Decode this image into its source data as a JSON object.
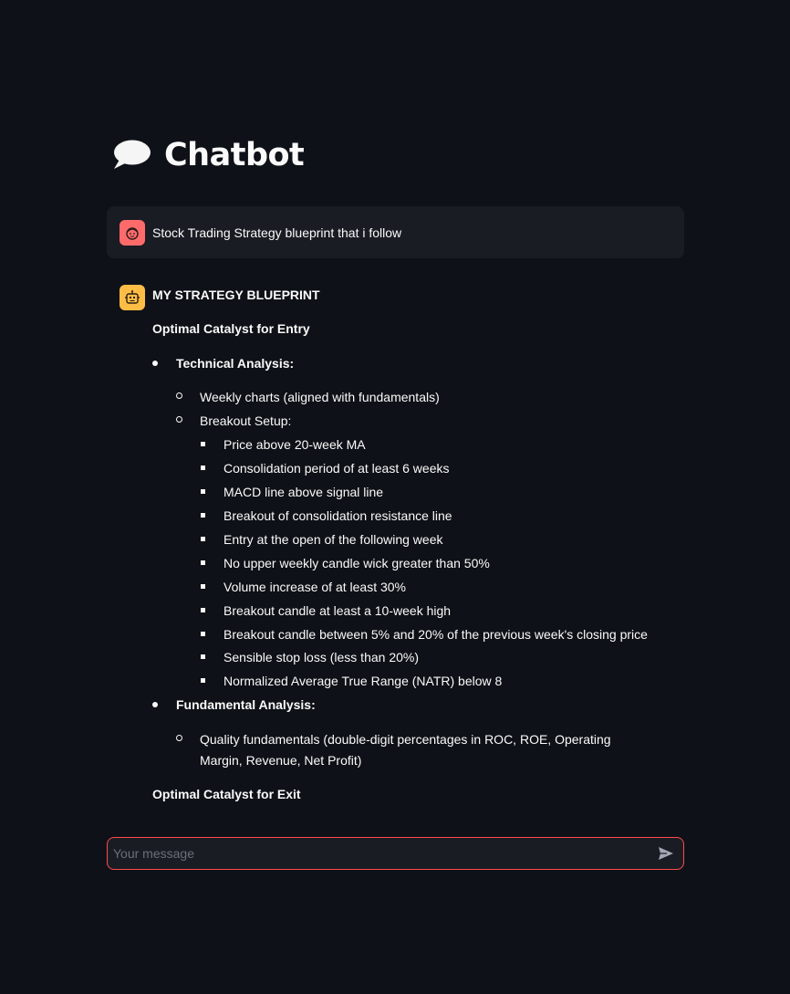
{
  "header": {
    "title": "Chatbot",
    "icon": "speech-bubble-icon"
  },
  "user_message": {
    "text": "Stock Trading Strategy blueprint that i follow"
  },
  "bot_message": {
    "heading": "MY STRATEGY BLUEPRINT",
    "entry_title": "Optimal Catalyst for Entry",
    "technical": {
      "label": "Technical Analysis:",
      "weekly": "Weekly charts (aligned with fundamentals)",
      "breakout_label": "Breakout Setup:",
      "breakout_items": [
        "Price above 20-week MA",
        "Consolidation period of at least 6 weeks",
        "MACD line above signal line",
        "Breakout of consolidation resistance line",
        "Entry at the open of the following week",
        "No upper weekly candle wick greater than 50%",
        "Volume increase of at least 30%",
        "Breakout candle at least a 10-week high",
        "Breakout candle between 5% and 20% of the previous week's closing price",
        "Sensible stop loss (less than 20%)",
        "Normalized Average True Range (NATR) below 8"
      ]
    },
    "fundamental": {
      "label": "Fundamental Analysis:",
      "quality": "Quality fundamentals (double-digit percentages in ROC, ROE, Operating Margin, Revenue, Net Profit)"
    },
    "exit_title": "Optimal Catalyst for Exit"
  },
  "chat_input": {
    "placeholder": "Your message",
    "value": ""
  },
  "colors": {
    "background": "#0e1117",
    "user_avatar": "#ff6b6b",
    "bot_avatar": "#ffbd45",
    "input_border": "#ff4b4b"
  }
}
